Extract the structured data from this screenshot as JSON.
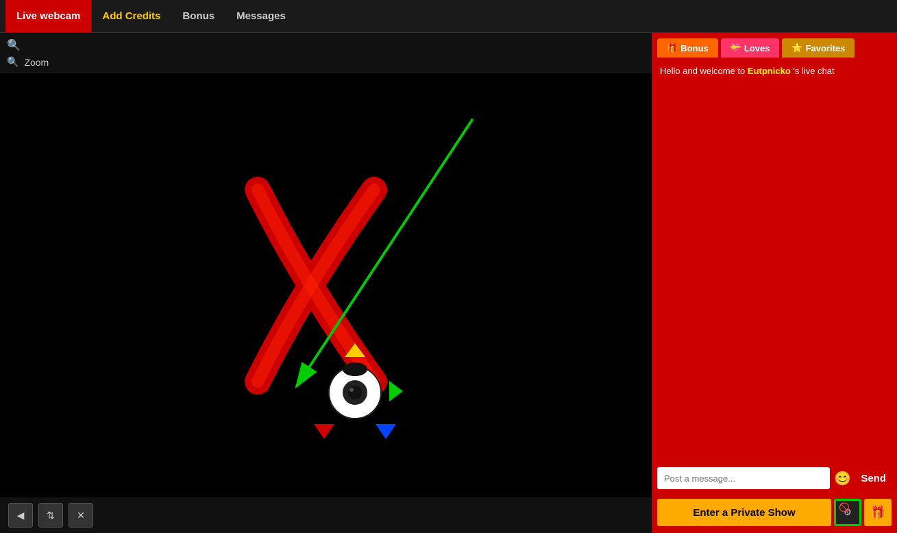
{
  "nav": {
    "items": [
      {
        "label": "Live webcam",
        "class": "active"
      },
      {
        "label": "Add Credits",
        "class": "highlight"
      },
      {
        "label": "Bonus",
        "class": ""
      },
      {
        "label": "Messages",
        "class": ""
      }
    ]
  },
  "webcam": {
    "zoom_label": "Zoom",
    "placeholder_image_alt": "Live webcam feed with X logo"
  },
  "bottom_controls": {
    "btn1": "◀",
    "btn2": "⇅",
    "btn3": "✕"
  },
  "chat": {
    "tabs": [
      {
        "label": "Bonus",
        "icon": "🎁",
        "class": "bonus"
      },
      {
        "label": "Loves",
        "icon": "💝",
        "class": "loves"
      },
      {
        "label": "Favorites",
        "icon": "⭐",
        "class": "favorites"
      }
    ],
    "welcome_text_pre": "Hello and welcome to ",
    "username": "Eutpnicko",
    "welcome_text_post": " 's live chat",
    "input_placeholder": "Post a message...",
    "send_label": "Send",
    "private_show_label": "Enter a Private Show"
  }
}
